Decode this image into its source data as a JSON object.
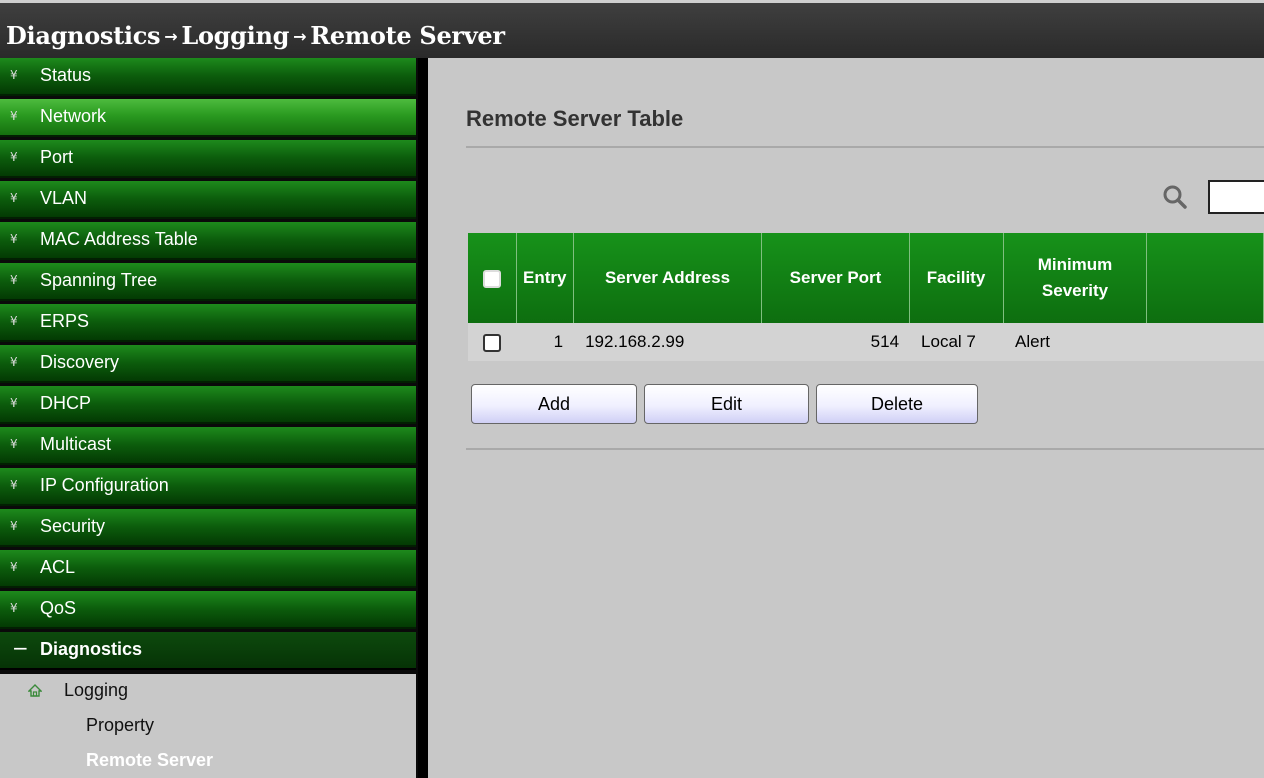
{
  "breadcrumb": [
    "Diagnostics",
    "Logging",
    "Remote Server"
  ],
  "breadcrumb_separator": "→",
  "sidebar": {
    "items": [
      {
        "label": "Status",
        "active": false
      },
      {
        "label": "Network",
        "active": true
      },
      {
        "label": "Port",
        "active": false
      },
      {
        "label": "VLAN",
        "active": false
      },
      {
        "label": "MAC Address Table",
        "active": false
      },
      {
        "label": "Spanning Tree",
        "active": false
      },
      {
        "label": "ERPS",
        "active": false
      },
      {
        "label": "Discovery",
        "active": false
      },
      {
        "label": "DHCP",
        "active": false
      },
      {
        "label": "Multicast",
        "active": false
      },
      {
        "label": "IP Configuration",
        "active": false
      },
      {
        "label": "Security",
        "active": false
      },
      {
        "label": "ACL",
        "active": false
      },
      {
        "label": "QoS",
        "active": false
      }
    ],
    "open_section": {
      "label": "Diagnostics",
      "expander": "−"
    },
    "sub": {
      "logging": "Logging",
      "property": "Property",
      "remote_server": "Remote Server"
    }
  },
  "main": {
    "title": "Remote Server Table",
    "search": {
      "value": ""
    },
    "table": {
      "headers": {
        "entry": "Entry",
        "server_address": "Server Address",
        "server_port": "Server Port",
        "facility": "Facility",
        "minimum_severity_line1": "Minimum",
        "minimum_severity_line2": "Severity"
      },
      "rows": [
        {
          "entry": "1",
          "server_address": "192.168.2.99",
          "server_port": "514",
          "facility": "Local 7",
          "minimum_severity": "Alert"
        }
      ]
    },
    "buttons": {
      "add": "Add",
      "edit": "Edit",
      "delete": "Delete"
    }
  },
  "colors": {
    "menu_green": "#0c5c0c",
    "menu_active_green": "#2a9a20",
    "table_header_green": "#17921a",
    "panel_gray": "#c8c8c8"
  }
}
